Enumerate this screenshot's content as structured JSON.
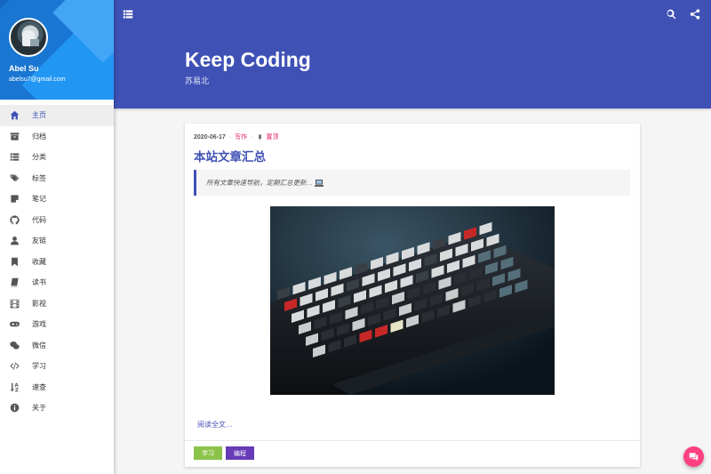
{
  "profile": {
    "name": "Abel Su",
    "email": "abelsu7@gmail.com"
  },
  "nav": [
    {
      "label": "主页",
      "icon": "home-icon",
      "active": true
    },
    {
      "label": "归档",
      "icon": "archive-icon"
    },
    {
      "label": "分类",
      "icon": "list-icon"
    },
    {
      "label": "标签",
      "icon": "tags-icon"
    },
    {
      "label": "笔记",
      "icon": "note-icon"
    },
    {
      "label": "代码",
      "icon": "github-icon"
    },
    {
      "label": "友链",
      "icon": "user-icon"
    },
    {
      "label": "收藏",
      "icon": "bookmark-icon"
    },
    {
      "label": "读书",
      "icon": "book-icon"
    },
    {
      "label": "影视",
      "icon": "film-icon"
    },
    {
      "label": "游戏",
      "icon": "gamepad-icon"
    },
    {
      "label": "微信",
      "icon": "wechat-icon"
    },
    {
      "label": "学习",
      "icon": "code-icon"
    },
    {
      "label": "速查",
      "icon": "sort-alpha-icon"
    },
    {
      "label": "关于",
      "icon": "info-icon"
    }
  ],
  "header": {
    "title": "Keep Coding",
    "subtitle": "苏易北"
  },
  "post": {
    "date": "2020-06-17",
    "category": "写作",
    "pinned_label": "置顶",
    "title": "本站文章汇总",
    "excerpt": "所有文章快速导航，定期汇总更新…",
    "read_more": "阅读全文…",
    "tags": [
      "学习",
      "编程"
    ]
  },
  "colors": {
    "primary": "#3f51b5",
    "accent": "#ff4081",
    "tag_green": "#8bc34a",
    "tag_purple": "#673ab7"
  }
}
